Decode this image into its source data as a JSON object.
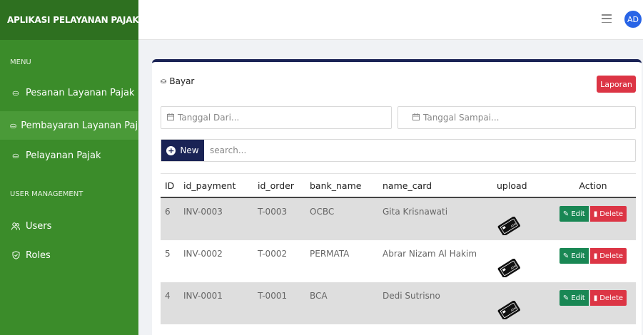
{
  "sidebar": {
    "brand": "APLIKASI PELAYANAN PAJAK",
    "menu_label": "MENU",
    "user_mgmt_label": "USER MANAGEMENT",
    "items": [
      {
        "label": "Pesanan Layanan Pajak",
        "icon": "coins-icon"
      },
      {
        "label": "Pembayaran Layanan Pajak",
        "icon": "coins-icon",
        "active": true
      },
      {
        "label": "Pelayanan Pajak",
        "icon": "coins-icon"
      },
      {
        "label": "Users",
        "icon": "users-icon"
      },
      {
        "label": "Roles",
        "icon": "shield-icon"
      }
    ]
  },
  "topbar": {
    "avatar": "AD"
  },
  "card": {
    "title": "Bayar",
    "laporan_label": "Laporan"
  },
  "filters": {
    "date_from_placeholder": "Tanggal Dari...",
    "date_to_placeholder": "Tanggal Sampai..."
  },
  "toolbar": {
    "new_label": "New",
    "search_placeholder": "search..."
  },
  "table": {
    "headers": [
      "ID",
      "id_payment",
      "id_order",
      "bank_name",
      "name_card",
      "upload",
      "Action"
    ],
    "rows": [
      {
        "id": "6",
        "id_payment": "INV-0003",
        "id_order": "T-0003",
        "bank_name": "OCBC",
        "name_card": "Gita Krisnawati"
      },
      {
        "id": "5",
        "id_payment": "INV-0002",
        "id_order": "T-0002",
        "bank_name": "PERMATA",
        "name_card": "Abrar Nizam Al Hakim"
      },
      {
        "id": "4",
        "id_payment": "INV-0001",
        "id_order": "T-0001",
        "bank_name": "BCA",
        "name_card": "Dedi Sutrisno"
      }
    ],
    "edit_label": "Edit",
    "delete_label": "Delete",
    "upload_text": "ATM"
  },
  "colors": {
    "sidebar": "#3b8c2a",
    "brand_bar": "#2e7020",
    "active_item": "#4a9a38",
    "navy": "#1a2355",
    "danger": "#dc3545",
    "success": "#198754",
    "avatar": "#2864e6"
  }
}
